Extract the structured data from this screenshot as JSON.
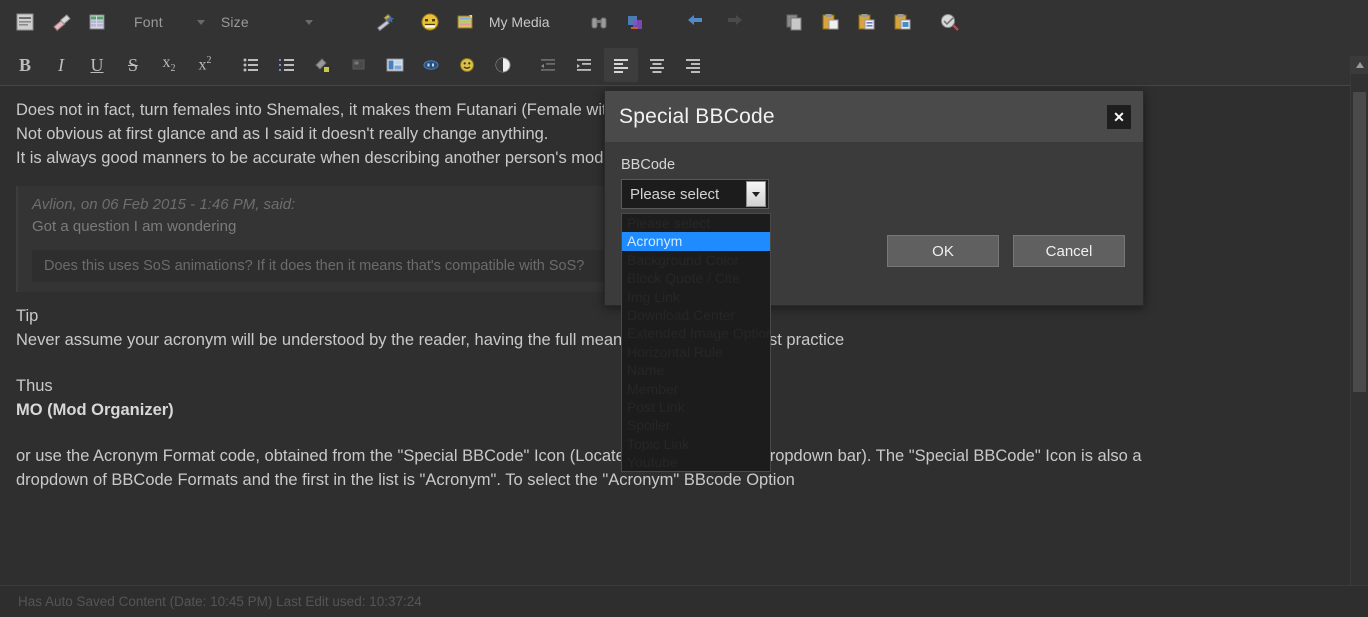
{
  "toolbar_top": {
    "buttons": [
      {
        "name": "source-view-icon",
        "title": "Toggle source"
      },
      {
        "name": "eraser-icon",
        "title": "Remove format"
      },
      {
        "name": "grid-table-icon",
        "title": "Insert table"
      }
    ],
    "font_select": {
      "label": "Font",
      "value": "Font"
    },
    "size_select": {
      "label": "Size",
      "value": "Size"
    },
    "special_bbcode_icon": "magic-wand-icon",
    "emoticon_icon": "smiley-icon",
    "my_media_icon": "my-media-icon",
    "my_media_label": "My Media",
    "find_icon": "binoculars-icon",
    "link_icon": "insert-link-icon",
    "undo_icon": "undo-arrow-icon",
    "redo_icon": "redo-arrow-icon",
    "copy_icon": "copy-icon",
    "paste_icon": "paste-icon",
    "paste_text_icon": "paste-text-icon",
    "paste_word_icon": "paste-word-icon",
    "spellcheck_icon": "spellcheck-icon"
  },
  "toolbar_format": {
    "bold": "B",
    "italic": "I",
    "underline": "U",
    "strike": "S",
    "subscript_base": "x",
    "subscript_mark": "2",
    "superscript_base": "x",
    "superscript_mark": "2",
    "bullet_list_icon": "bullet-list-icon",
    "numbered_list_icon": "numbered-list-icon",
    "paint-format_icon": "paint-format-icon",
    "special_char_icon": "special-character-icon",
    "image_icon": "insert-image-icon",
    "quote_icon": "quote-bubble-icon",
    "smiley_icon": "smiley-round-icon",
    "contrast_icon": "text-color-icon",
    "outdent_icon": "outdent-icon",
    "indent_icon": "indent-icon",
    "align_left_icon": "align-left-icon",
    "align_center_icon": "align-center-icon",
    "align_right_icon": "align-right-icon"
  },
  "editor": {
    "line1": "Does not in fact, turn females into Shemales, it makes them Futanari (Female with a Penis and Testicles).",
    "line2": "Not obvious at first glance and as I said it doesn't really change anything.",
    "line3": "It is always good manners to be accurate when describing another person's mod.",
    "quote": {
      "attribution": "Avlion, on 06 Feb 2015 - 1:46 PM, said:",
      "text": "Got a question I am wondering",
      "inner": "Does this uses SoS animations? If it does then it means that's compatible with SoS?"
    },
    "tip_heading": "Tip",
    "tip_text": "Never assume your acronym will be understood by the reader, having the full meaning on first use is best practice",
    "thus_heading": "Thus",
    "thus_value": "MO (Mod Organizer)",
    "para1": "or use the Acronym Format code, obtained from the \"Special BBCode\" Icon (Located next to the Font Dropdown bar). The \"Special BBCode\" Icon is also a",
    "para2": "dropdown of BBCode Formats and the first in the list is \"Acronym\". To select the \"Acronym\" BBcode Option"
  },
  "statusbar": {
    "text": "Has Auto Saved Content (Date: 10:45 PM) Last Edit used: 10:37:24"
  },
  "modal": {
    "title": "Special BBCode",
    "close_label": "✕",
    "field_label": "BBCode",
    "select_value": "Please select",
    "options": [
      "Please select",
      "Acronym",
      "Background Color",
      "Block Quote / Cite",
      "Img Link",
      "Download Center",
      "Extended Image Option",
      "Horizontal Rule",
      "Name",
      "Member",
      "Post Link",
      "Spoiler",
      "Topic Link",
      "Youtube"
    ],
    "selected_option": "Acronym",
    "ok_label": "OK",
    "cancel_label": "Cancel"
  },
  "colors": {
    "accent": "#1e8bff",
    "panel": "#3b3b3b",
    "header": "#4a4a4a",
    "background": "#2f2f2f"
  }
}
